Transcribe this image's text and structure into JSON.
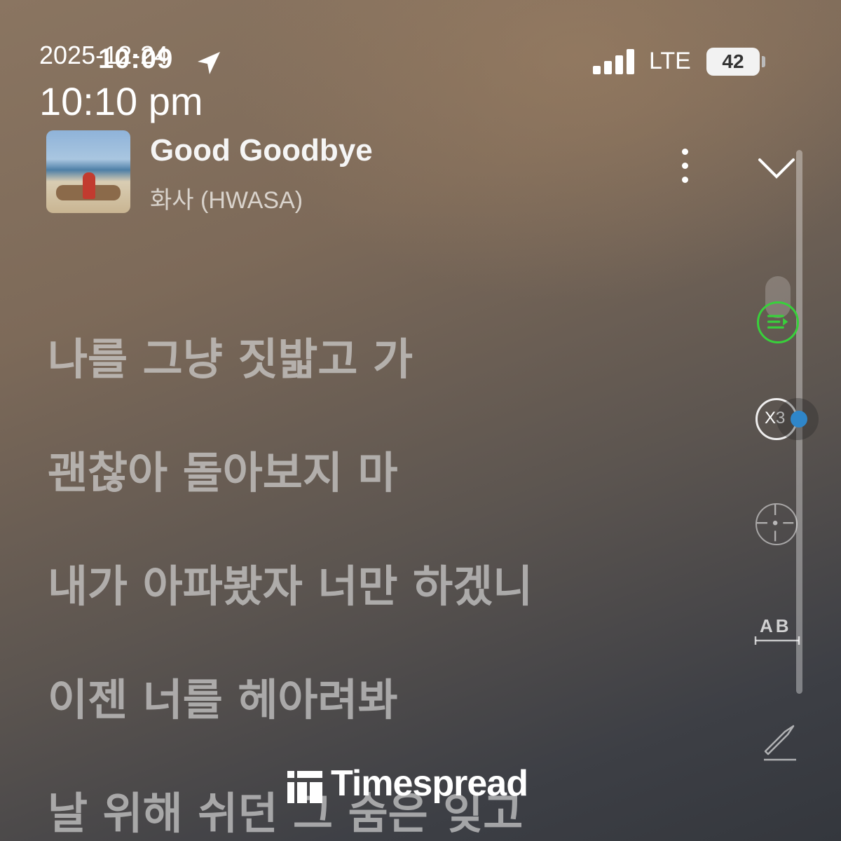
{
  "status_bar": {
    "time": "10:09",
    "network": "LTE",
    "battery": "42"
  },
  "timestamp_overlay": {
    "date": "2025-12-24",
    "time": "10:10 pm"
  },
  "now_playing": {
    "title": "Good Goodbye",
    "artist": "화사 (HWASA)"
  },
  "side_controls": {
    "speed_label": "X3",
    "ab_label": "AB"
  },
  "lyrics": [
    "나를 그냥 짓밟고 가",
    "괜찮아 돌아보지 마",
    "내가 아파봤자 너만 하겠니",
    "이젠 너를 헤아려봐",
    "날 위해 쉬던 그 숨은 잊고"
  ],
  "watermark": {
    "brand": "Timespread"
  },
  "colors": {
    "active_control": "#38d13b",
    "speed_knob": "#2f86c9"
  }
}
